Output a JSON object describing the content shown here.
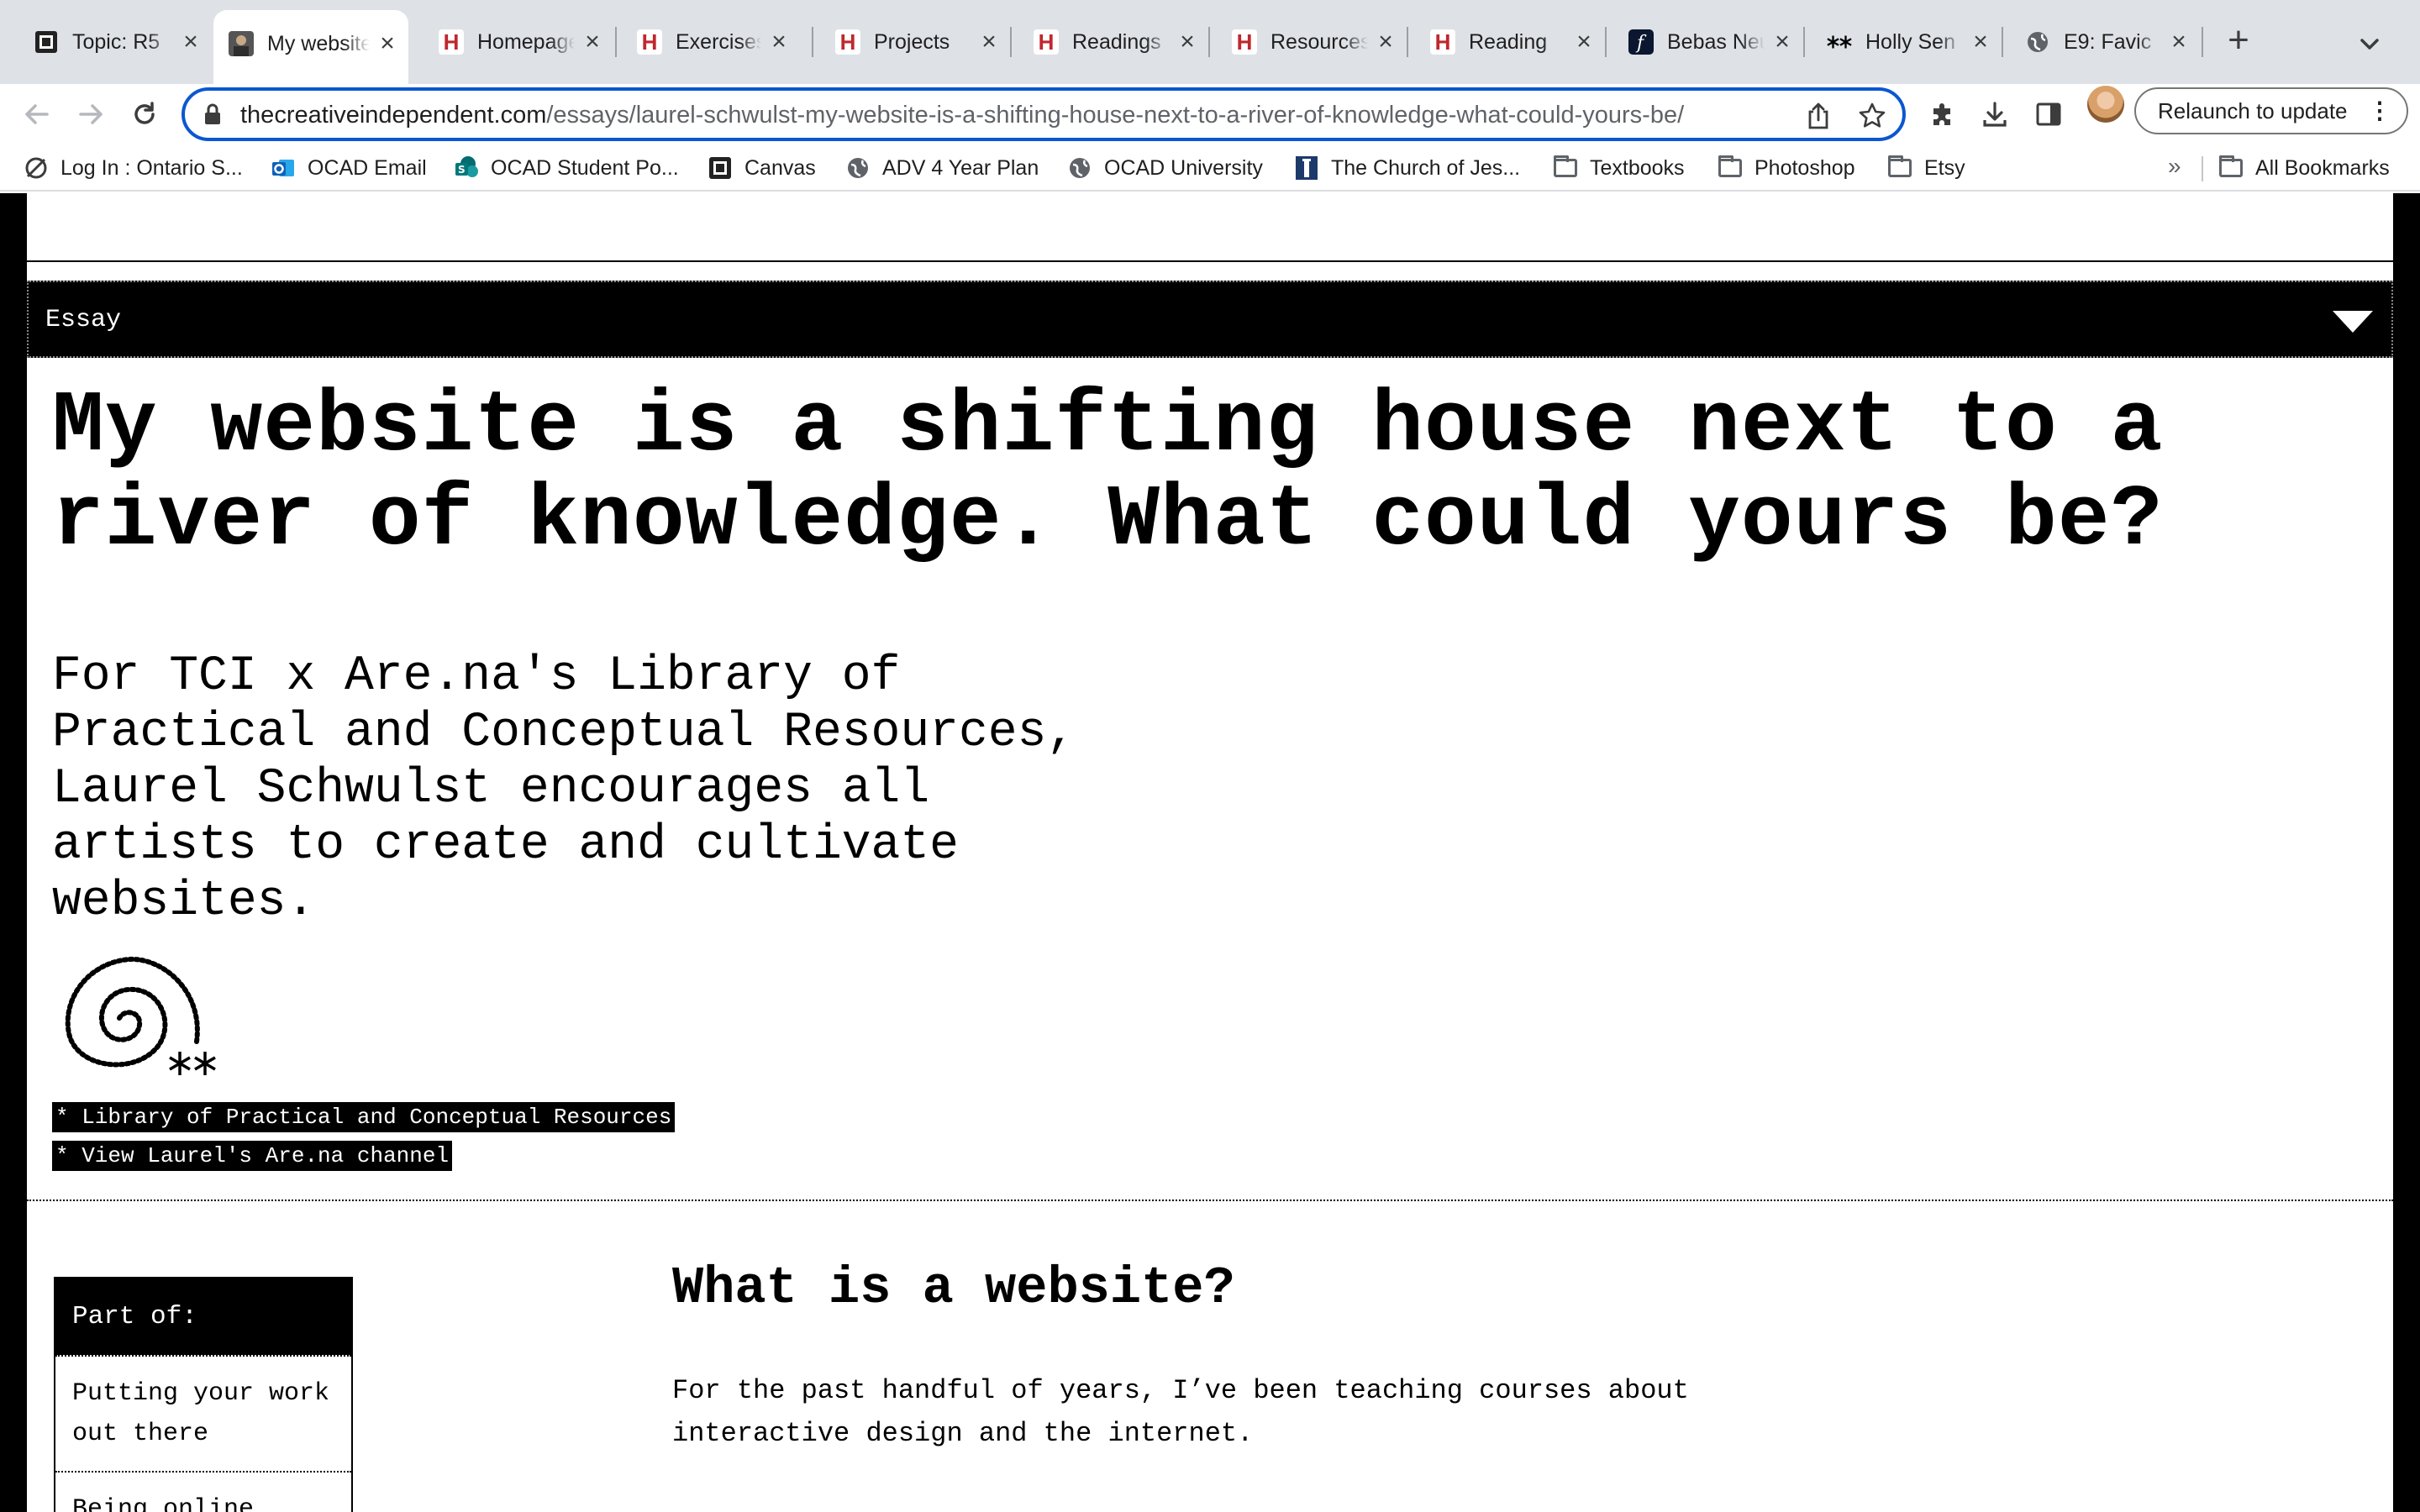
{
  "tabs": [
    {
      "title": "Topic: R5",
      "icon": "canvas-icon"
    },
    {
      "title": "My website",
      "icon": "profile-photo-icon"
    },
    {
      "title": "Homepage",
      "icon": "h-icon"
    },
    {
      "title": "Exercises",
      "icon": "h-icon"
    },
    {
      "title": "Projects",
      "icon": "h-icon"
    },
    {
      "title": "Readings",
      "icon": "h-icon"
    },
    {
      "title": "Resources",
      "icon": "h-icon"
    },
    {
      "title": "Reading",
      "icon": "h-icon"
    },
    {
      "title": "Bebas Neue",
      "icon": "fontshare-icon"
    },
    {
      "title": "Holly Sen",
      "icon": "asterisk-icon"
    },
    {
      "title": "E9: Favic",
      "icon": "globe-icon"
    }
  ],
  "toolbar": {
    "url_domain": "thecreativeindependent.com",
    "url_path": "/essays/laurel-schwulst-my-website-is-a-shifting-house-next-to-a-river-of-knowledge-what-could-yours-be/",
    "relaunch_label": "Relaunch to update"
  },
  "bookmarks": [
    {
      "label": "Log In : Ontario S...",
      "icon": "login-icon"
    },
    {
      "label": "OCAD Email",
      "icon": "outlook-icon"
    },
    {
      "label": "OCAD Student Po...",
      "icon": "sharepoint-icon"
    },
    {
      "label": "Canvas",
      "icon": "canvas-icon"
    },
    {
      "label": "ADV 4 Year Plan",
      "icon": "globe-icon"
    },
    {
      "label": "OCAD University",
      "icon": "globe-icon"
    },
    {
      "label": "The Church of Jes...",
      "icon": "church-icon"
    },
    {
      "label": "Textbooks",
      "icon": "folder-icon"
    },
    {
      "label": "Photoshop",
      "icon": "folder-icon"
    },
    {
      "label": "Etsy",
      "icon": "folder-icon"
    }
  ],
  "bookmarks_overflow": "»",
  "all_bookmarks_label": "All Bookmarks",
  "page": {
    "section_label": "Essay",
    "headline": "My website is a shifting house next to a river of knowledge. What could yours be?",
    "dek": "For TCI x Are.na's Library of Practical and Conceptual Resources, Laurel Schwulst encourages all artists to create and cultivate websites.",
    "links": [
      "* Library of Practical and Conceptual Resources",
      "* View Laurel's Are.na channel"
    ],
    "part_of": {
      "heading": "Part of:",
      "items": [
        "Putting your work out there",
        "Being online"
      ]
    },
    "section_heading": "What is a website?",
    "body": "For the past handful of years, I’ve been teaching courses about interactive design and the internet."
  },
  "colors": {
    "accent": "#0b57d0",
    "tab_bg": "#dee1e6",
    "page_frame": "#000000",
    "h_favicon": "#c0272d"
  }
}
